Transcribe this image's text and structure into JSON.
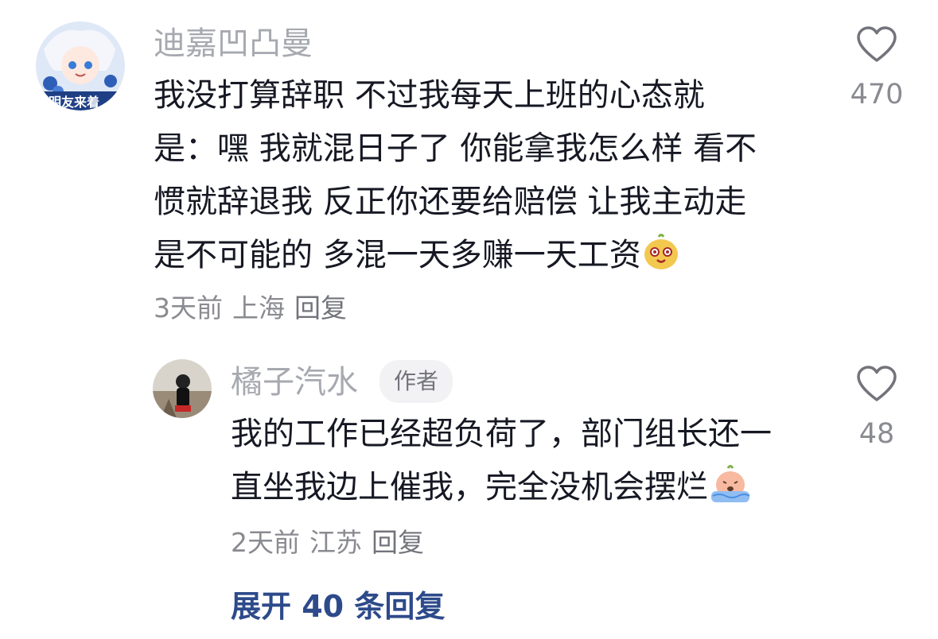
{
  "comments": [
    {
      "username": "迪嘉凹凸曼",
      "avatar_text": "明友来着",
      "lines": [
        "我没打算辞职 不过我每天上班的心态就",
        "是：嘿 我就混日子了 你能拿我怎么样 看不",
        "惯就辞退我 反正你还要给赔偿 让我主动走",
        "是不可能的 多混一天多赚一天工资"
      ],
      "emoji": "potato-smile-emoji",
      "time": "3天前",
      "location": "上海",
      "reply_label": "回复",
      "like_count": "470"
    }
  ],
  "reply": {
    "username": "橘子汽水",
    "badge": "作者",
    "lines": [
      "我的工作已经超负荷了，部门组长还一",
      "直坐我边上催我，完全没机会摆烂"
    ],
    "emoji": "crying-peach-emoji",
    "time": "2天前",
    "location": "江苏",
    "reply_label": "回复",
    "like_count": "48"
  },
  "expand_label": "展开 40 条回复"
}
